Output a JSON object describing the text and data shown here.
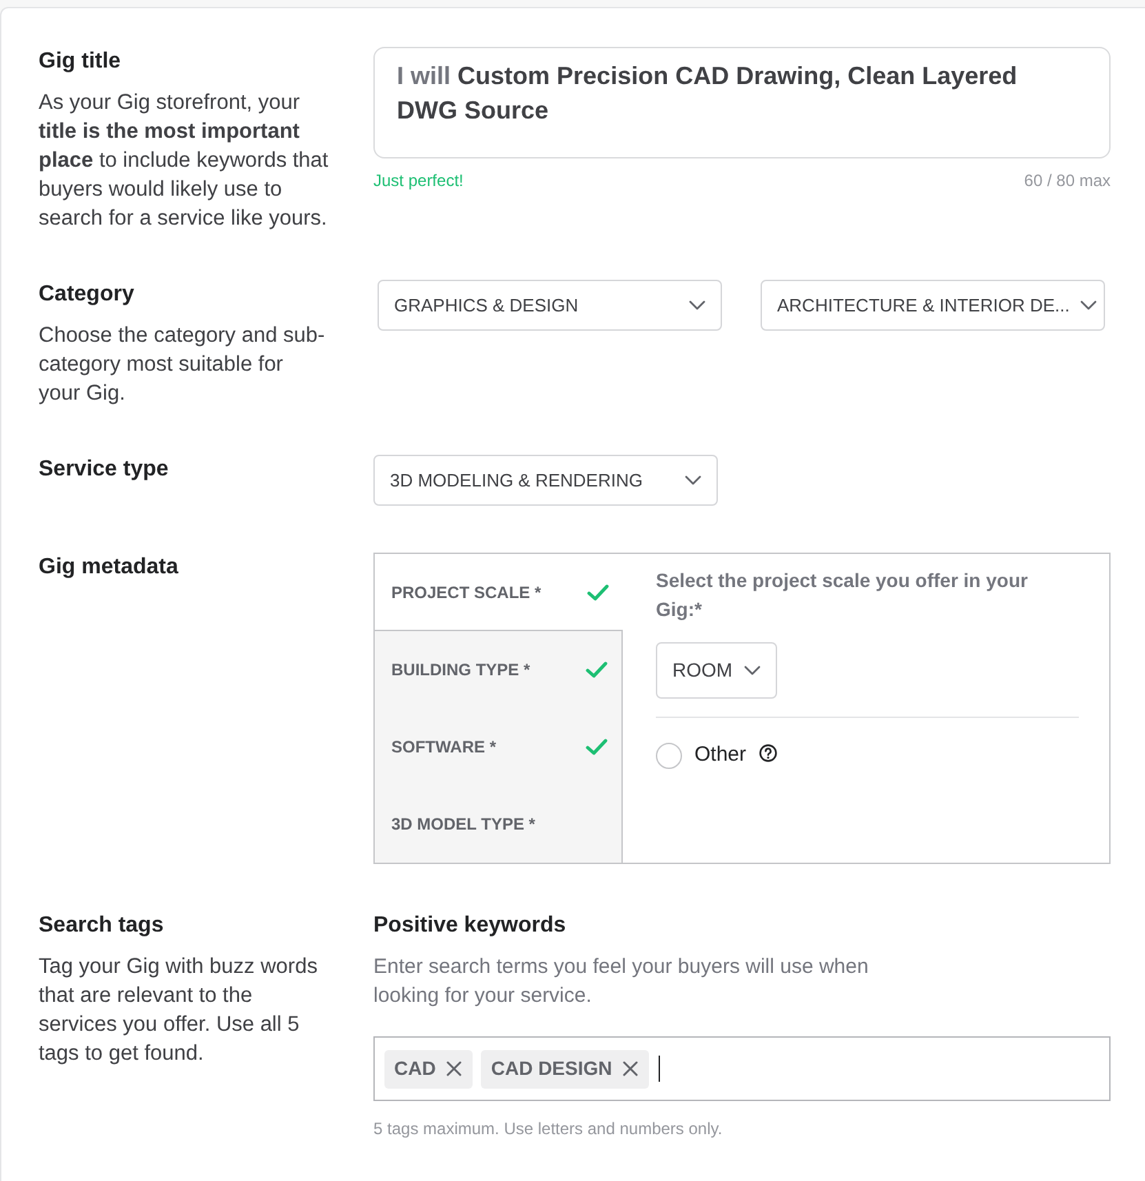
{
  "gig_title": {
    "heading": "Gig title",
    "description": "As your Gig storefront, your **title is the most important place** to include keywords that buyers would likely use to search for a service like yours.",
    "prefix": "I will",
    "value": "Custom Precision CAD Drawing, Clean Layered DWG Source",
    "feedback": "Just perfect!",
    "counter": "60 / 80 max"
  },
  "category": {
    "heading": "Category",
    "description": "Choose the category and sub-category most suitable for your Gig.",
    "dropdowns": [
      {
        "value": "GRAPHICS & DESIGN"
      },
      {
        "value": "ARCHITECTURE & INTERIOR DE..."
      }
    ]
  },
  "service_type": {
    "heading": "Service type",
    "dropdown": {
      "value": "3D MODELING & RENDERING"
    }
  },
  "gig_metadata": {
    "heading": "Gig metadata",
    "tabs": [
      {
        "label": "PROJECT SCALE *",
        "selected": true,
        "completed": true
      },
      {
        "label": "BUILDING TYPE *",
        "selected": false,
        "completed": true
      },
      {
        "label": "SOFTWARE *",
        "selected": false,
        "completed": true
      },
      {
        "label": "3D MODEL TYPE *",
        "selected": false,
        "completed": false
      }
    ],
    "question": "Select the project scale you offer in your Gig:*",
    "dropdown": {
      "value": "ROOM"
    },
    "options": [
      {
        "label": "Other",
        "selected": false
      }
    ]
  },
  "search_tags": {
    "heading": "Search tags",
    "description": "Tag your Gig with buzz words that are relevant to the services you offer. Use all 5 tags to get found.",
    "subheading": "Positive keywords",
    "subdescription": "Enter search terms you feel your buyers will use when looking for your service.",
    "tags": [
      {
        "label": "CAD"
      },
      {
        "label": "CAD DESIGN"
      }
    ],
    "focused": true,
    "hint": "5 tags maximum. Use letters and numbers only."
  }
}
